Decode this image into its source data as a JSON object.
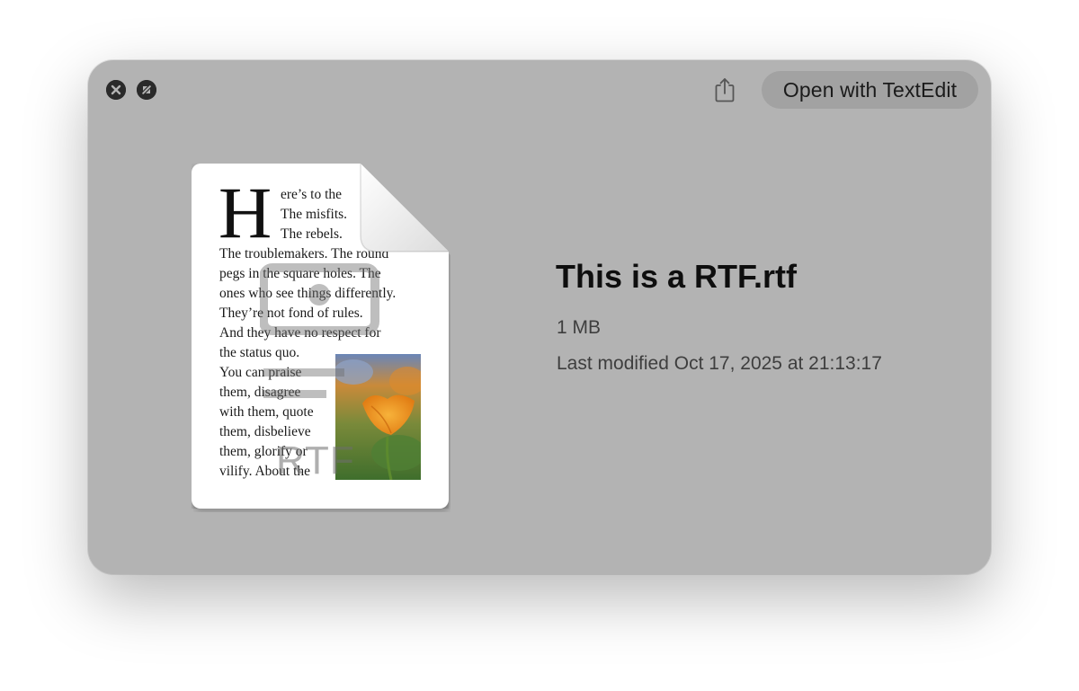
{
  "toolbar": {
    "open_button_label": "Open with TextEdit",
    "close_icon": "close-icon",
    "fullscreen_icon": "fullscreen-icon",
    "share_icon": "share-icon"
  },
  "preview": {
    "dropcap": "H",
    "lines": [
      "ere’s to the",
      "The misfits.",
      "The rebels.",
      "The troublemakers. The round",
      "pegs in the square holes. The",
      "ones who see things differently.",
      "They’re not fond of rules.",
      "And they have no respect for",
      "the status quo.",
      "You can praise",
      "them, disagree",
      "with them, quote",
      "them, disbelieve",
      "them, glorify or",
      "vilify. About the"
    ],
    "watermark_label": "RTF"
  },
  "file": {
    "name": "This is a RTF.rtf",
    "size": "1 MB",
    "modified": "Last modified Oct 17, 2025 at 21:13:17"
  },
  "colors": {
    "window_bg": "#b3b3b3",
    "button_bg": "#a2a2a2",
    "title_text": "#0e0e0e",
    "meta_text": "#3e3e3e"
  }
}
